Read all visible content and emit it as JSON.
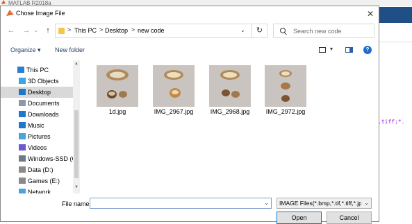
{
  "background": {
    "app_title": "MATLAB R2018a",
    "code_snippet": ".tiff;*."
  },
  "dialog": {
    "title": "Chose Image File",
    "close_glyph": "✕"
  },
  "nav": {
    "back_glyph": "←",
    "forward_glyph": "→",
    "recent_glyph": "⌄",
    "up_glyph": "↑",
    "breadcrumbs": [
      "This PC",
      "Desktop",
      "new code"
    ],
    "separator": ">",
    "dropdown_glyph": "⌄",
    "refresh_glyph": "↻",
    "search_placeholder": "Search new code"
  },
  "toolbar": {
    "organize_label": "Organize ▾",
    "new_folder_label": "New folder",
    "view_dd_glyph": "▾",
    "help_glyph": "?"
  },
  "navpane": {
    "items": [
      {
        "label": "This PC",
        "icon": "computer-icon",
        "color": "#2a7fd4",
        "selected": false
      },
      {
        "label": "3D Objects",
        "icon": "cube-icon",
        "color": "#3da4e6",
        "selected": false
      },
      {
        "label": "Desktop",
        "icon": "desktop-icon",
        "color": "#1e78c8",
        "selected": true
      },
      {
        "label": "Documents",
        "icon": "document-icon",
        "color": "#8a9aaa",
        "selected": false
      },
      {
        "label": "Downloads",
        "icon": "download-icon",
        "color": "#1f77d0",
        "selected": false
      },
      {
        "label": "Music",
        "icon": "music-icon",
        "color": "#1f77d0",
        "selected": false
      },
      {
        "label": "Pictures",
        "icon": "pictures-icon",
        "color": "#4aa3df",
        "selected": false
      },
      {
        "label": "Videos",
        "icon": "videos-icon",
        "color": "#6a5acd",
        "selected": false
      },
      {
        "label": "Windows-SSD (C",
        "icon": "drive-windows-icon",
        "color": "#6c7a89",
        "selected": false
      },
      {
        "label": "Data (D:)",
        "icon": "drive-icon",
        "color": "#8a8a8a",
        "selected": false
      },
      {
        "label": "Games (E:)",
        "icon": "drive-icon",
        "color": "#8a8a8a",
        "selected": false
      },
      {
        "label": "Network",
        "icon": "network-icon",
        "color": "#4aa3df",
        "selected": false
      }
    ]
  },
  "files": [
    {
      "name": "1d.jpg"
    },
    {
      "name": "IMG_2967.jpg"
    },
    {
      "name": "IMG_2968.jpg"
    },
    {
      "name": "IMG_2972.jpg"
    }
  ],
  "footer": {
    "file_name_label": "File name:",
    "file_name_value": "",
    "dd_glyph": "⌄",
    "filter_label": "IMAGE Files(*.bmp,*.tif,*.tiff,*.jpg",
    "open_label": "Open",
    "cancel_label": "Cancel"
  },
  "colors": {
    "accent": "#0078d7",
    "selection": "#d9d9d9",
    "folder": "#f4c64a",
    "matlab_blue": "#1f4f85"
  }
}
